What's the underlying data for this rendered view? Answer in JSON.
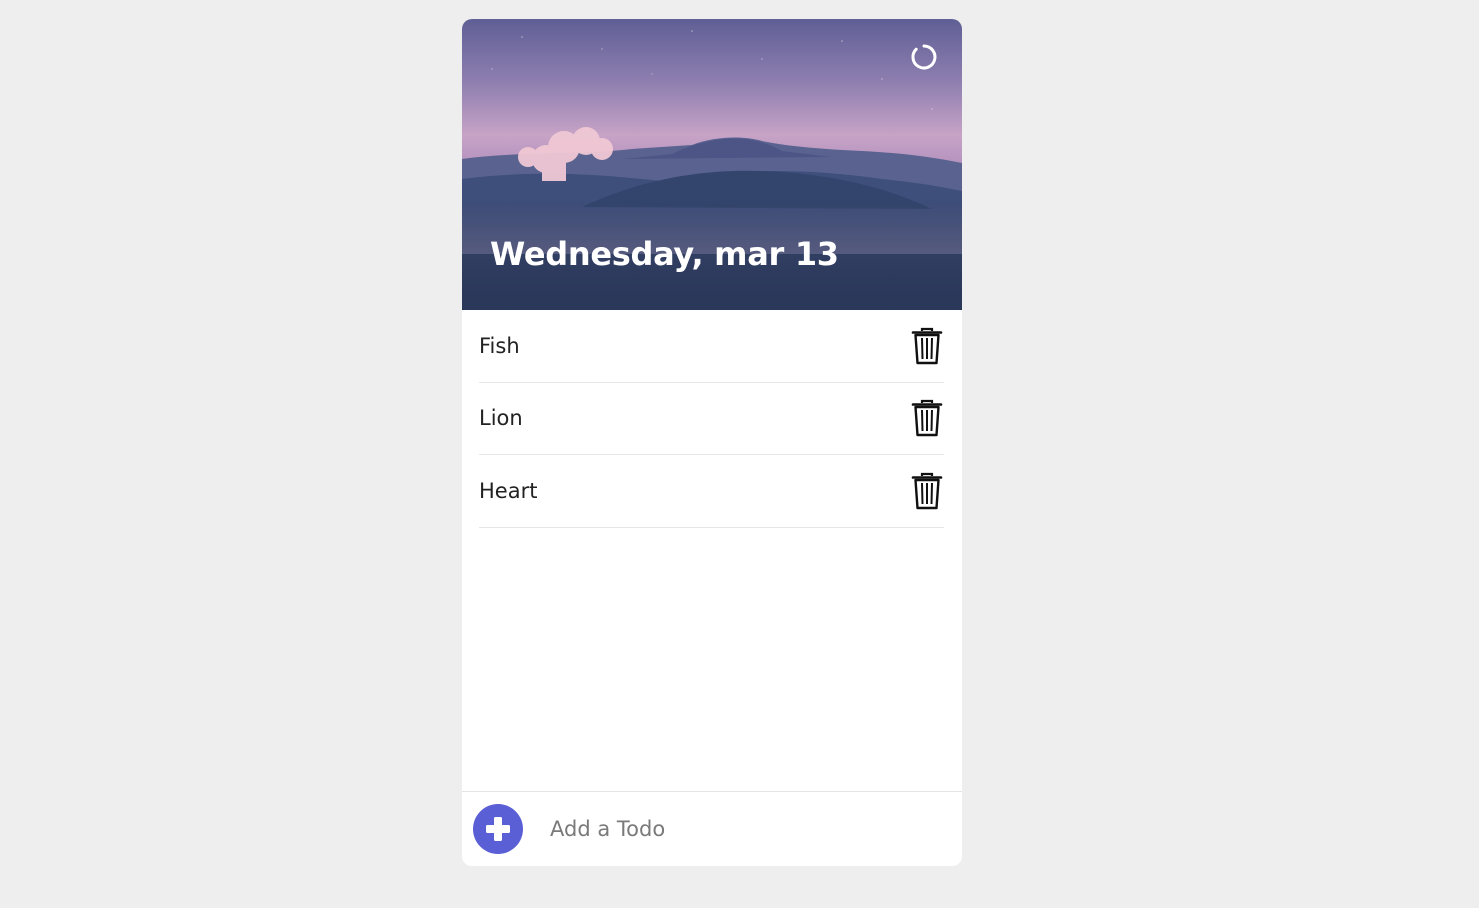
{
  "header": {
    "date": "Wednesday, mar 13",
    "refresh_icon": "refresh-circle-icon"
  },
  "todos": [
    {
      "label": "Fish",
      "delete_icon": "trash-icon"
    },
    {
      "label": "Lion",
      "delete_icon": "trash-icon"
    },
    {
      "label": "Heart",
      "delete_icon": "trash-icon"
    }
  ],
  "footer": {
    "add_icon": "plus-icon",
    "input_placeholder": "Add a Todo",
    "input_value": ""
  },
  "colors": {
    "page_background": "#eeeeee",
    "accent": "#5b5fd6",
    "card": "#ffffff"
  }
}
